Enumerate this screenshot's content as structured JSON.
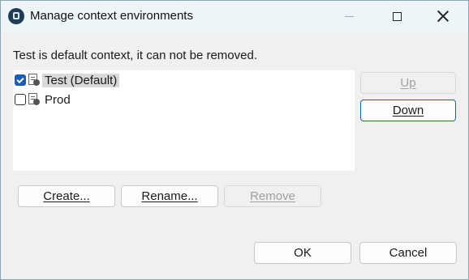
{
  "window": {
    "title": "Manage context environments"
  },
  "message": "Test is default context, it can not be removed.",
  "contexts": [
    {
      "label": "Test (Default)",
      "checked": true,
      "selected": true
    },
    {
      "label": "Prod",
      "checked": false,
      "selected": false
    }
  ],
  "buttons": {
    "up": "Up",
    "down": "Down",
    "create": "Create...",
    "rename": "Rename...",
    "remove": "Remove",
    "ok": "OK",
    "cancel": "Cancel"
  },
  "icons": {
    "app": "app-icon",
    "context": "context-icon",
    "minimize": "minimize-icon",
    "maximize": "maximize-icon",
    "close": "close-icon"
  },
  "colors": {
    "accent": "#1a5fb4",
    "titlebar": "#eef5f8",
    "selection": "#d9d9d9"
  }
}
